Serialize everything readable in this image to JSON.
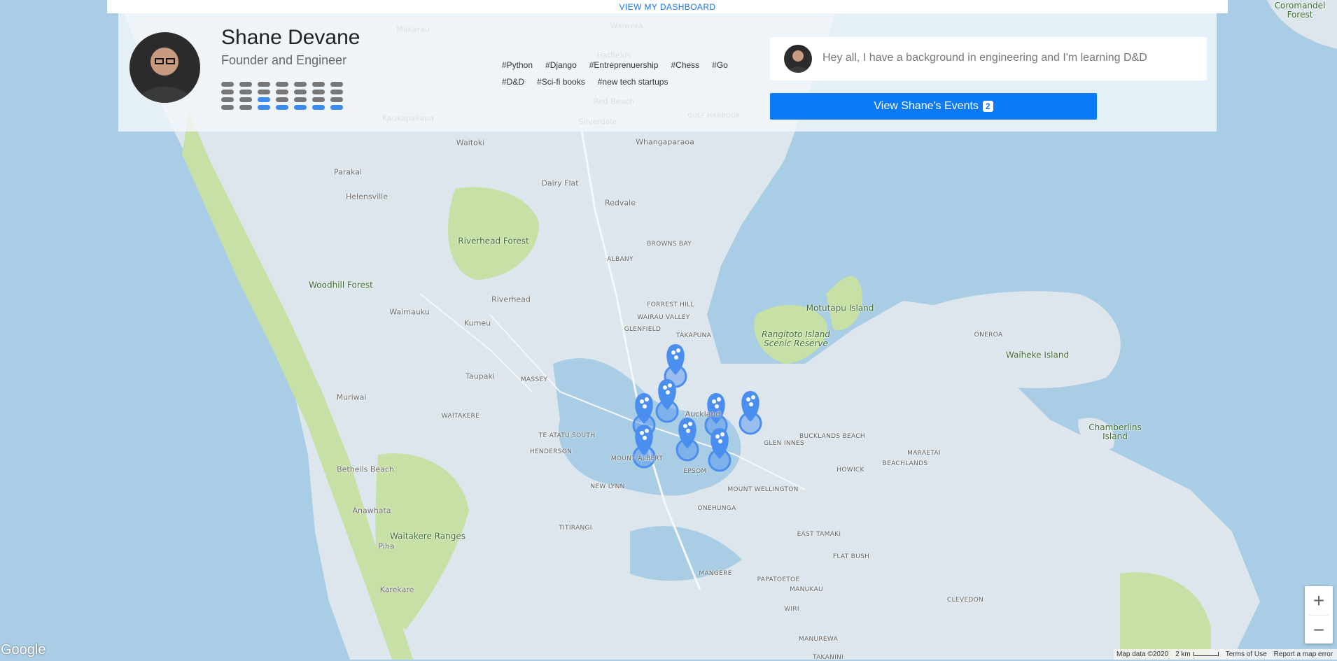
{
  "top_bar": {
    "dashboard_link": "VIEW MY DASHBOARD"
  },
  "profile": {
    "name": "Shane Devane",
    "role": "Founder and Engineer",
    "tags": [
      "#Python",
      "#Django",
      "#Entreprenuership",
      "#Chess",
      "#Go",
      "#D&D",
      "#Sci-fi books",
      "#new tech startups"
    ],
    "bio": "Hey all, I have a background in engineering and I'm learning D&D",
    "events_button": "View Shane's Events",
    "events_count": "2",
    "availability_grid": [
      [
        0,
        0,
        0,
        0,
        0,
        0,
        0
      ],
      [
        0,
        0,
        0,
        0,
        0,
        0,
        0
      ],
      [
        0,
        0,
        1,
        0,
        0,
        0,
        0
      ],
      [
        0,
        0,
        1,
        1,
        1,
        1,
        1
      ]
    ]
  },
  "map": {
    "zoom_in": "+",
    "zoom_out": "−",
    "google_logo": "Google",
    "footer": {
      "map_data": "Map data ©2020",
      "scale": "2 km",
      "terms": "Terms of Use",
      "report": "Report a map error"
    },
    "places": [
      {
        "name": "Makarau",
        "cls": "town"
      },
      {
        "name": "Waiwera",
        "cls": "town"
      },
      {
        "name": "Hatfields",
        "cls": "town"
      },
      {
        "name": "Red Beach",
        "cls": "town"
      },
      {
        "name": "Waitoki",
        "cls": "town"
      },
      {
        "name": "Kaukapakapa",
        "cls": "town"
      },
      {
        "name": "Silverdale",
        "cls": "town"
      },
      {
        "name": "GULF HARBOUR",
        "cls": "sub"
      },
      {
        "name": "Whangaparaoa",
        "cls": "town"
      },
      {
        "name": "Parakai",
        "cls": "town"
      },
      {
        "name": "Helensville",
        "cls": "town"
      },
      {
        "name": "Dairy Flat",
        "cls": "town"
      },
      {
        "name": "Redvale",
        "cls": "town"
      },
      {
        "name": "Riverhead Forest",
        "cls": "park"
      },
      {
        "name": "BROWNS BAY",
        "cls": "sub"
      },
      {
        "name": "ALBANY",
        "cls": "sub"
      },
      {
        "name": "Woodhill Forest",
        "cls": "park"
      },
      {
        "name": "Riverhead",
        "cls": "town"
      },
      {
        "name": "FORREST HILL",
        "cls": "sub"
      },
      {
        "name": "WAIRAU VALLEY",
        "cls": "sub"
      },
      {
        "name": "Waimauku",
        "cls": "town"
      },
      {
        "name": "Kumeu",
        "cls": "town"
      },
      {
        "name": "GLENFIELD",
        "cls": "sub"
      },
      {
        "name": "TAKAPUNA",
        "cls": "sub"
      },
      {
        "name": "Rangitoto Island Scenic Reserve",
        "cls": "park italic"
      },
      {
        "name": "Motutapu Island",
        "cls": "park"
      },
      {
        "name": "ONEROA",
        "cls": "sub"
      },
      {
        "name": "Waiheke Island",
        "cls": "park"
      },
      {
        "name": "Taupaki",
        "cls": "town"
      },
      {
        "name": "MASSEY",
        "cls": "sub"
      },
      {
        "name": "Muriwai",
        "cls": "town"
      },
      {
        "name": "WAITAKERE",
        "cls": "sub"
      },
      {
        "name": "Auckland",
        "cls": "town"
      },
      {
        "name": "TE ATATU SOUTH",
        "cls": "sub"
      },
      {
        "name": "HENDERSON",
        "cls": "sub"
      },
      {
        "name": "MOUNT ALBERT",
        "cls": "sub"
      },
      {
        "name": "EPSOM",
        "cls": "sub"
      },
      {
        "name": "GLEN INNES",
        "cls": "sub"
      },
      {
        "name": "BUCKLANDS BEACH",
        "cls": "sub"
      },
      {
        "name": "Chamberlins Island",
        "cls": "park"
      },
      {
        "name": "MARAETAI",
        "cls": "sub"
      },
      {
        "name": "BEACHLANDS",
        "cls": "sub"
      },
      {
        "name": "HOWICK",
        "cls": "sub"
      },
      {
        "name": "Bethells Beach",
        "cls": "town"
      },
      {
        "name": "NEW LYNN",
        "cls": "sub"
      },
      {
        "name": "MOUNT WELLINGTON",
        "cls": "sub"
      },
      {
        "name": "ONEHUNGA",
        "cls": "sub"
      },
      {
        "name": "Anawhata",
        "cls": "town"
      },
      {
        "name": "Waitakere Ranges",
        "cls": "park"
      },
      {
        "name": "TITIRANGI",
        "cls": "sub"
      },
      {
        "name": "EAST TAMAKI",
        "cls": "sub"
      },
      {
        "name": "Piha",
        "cls": "town"
      },
      {
        "name": "FLAT BUSH",
        "cls": "sub"
      },
      {
        "name": "MANGERE",
        "cls": "sub"
      },
      {
        "name": "PAPATOETOE",
        "cls": "sub"
      },
      {
        "name": "MANUKAU",
        "cls": "sub"
      },
      {
        "name": "Karekare",
        "cls": "town"
      },
      {
        "name": "CLEVEDON",
        "cls": "sub"
      },
      {
        "name": "WIRI",
        "cls": "sub"
      },
      {
        "name": "MANUREWA",
        "cls": "sub"
      },
      {
        "name": "TAKANINI",
        "cls": "sub"
      },
      {
        "name": "Coromandel Forest",
        "cls": "park"
      }
    ]
  },
  "colors": {
    "accent": "#0b7af7",
    "marker": "#4a8ef0",
    "water": "#a9cde4",
    "land": "#dde6ec",
    "park": "#c7e0a5"
  }
}
